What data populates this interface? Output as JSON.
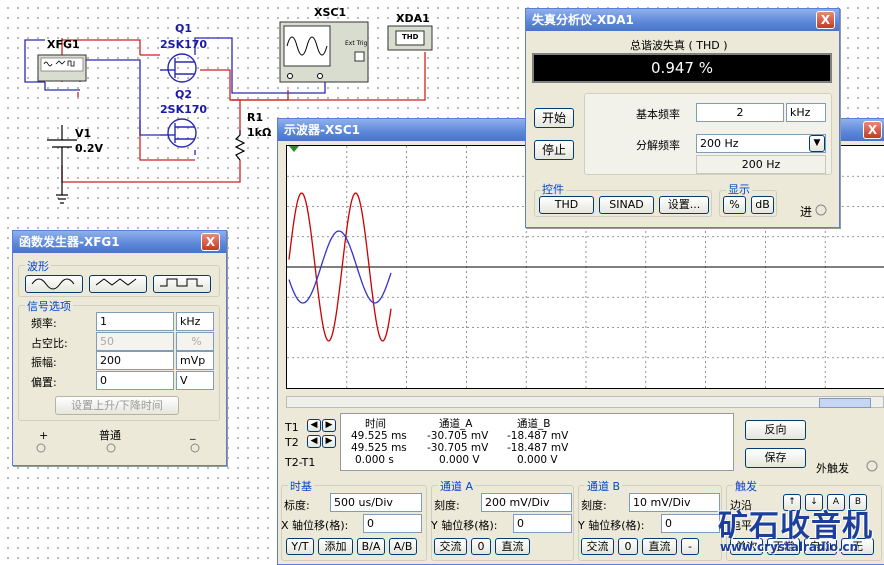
{
  "schematic": {
    "xfg1": "XFG1",
    "q1": "Q1",
    "q1_part": "2SK170",
    "q2": "Q2",
    "q2_part": "2SK170",
    "xsc1": "XSC1",
    "xsc1_ext": "Ext Trig",
    "xda1": "XDA1",
    "xda1_thd": "THD",
    "r1": "R1",
    "r1_val": "1kΩ",
    "v1": "V1",
    "v1_val": "0.2V"
  },
  "func_gen": {
    "title": "函数发生器-XFG1",
    "close": "X",
    "waveform_group": "波形",
    "signal_group": "信号选项",
    "freq_label": "频率:",
    "freq_value": "1",
    "freq_unit": "kHz",
    "duty_label": "占空比:",
    "duty_value": "50",
    "duty_unit": "%",
    "amp_label": "振幅:",
    "amp_value": "200",
    "amp_unit": "mVp",
    "offset_label": "偏置:",
    "offset_value": "0",
    "offset_unit": "V",
    "rise_fall_button": "设置上升/下降时间",
    "plus": "+",
    "common": "普通",
    "minus": "_"
  },
  "distortion": {
    "title": "失真分析仪-XDA1",
    "close": "X",
    "header": "总谐波失真 ( THD )",
    "reading": "0.947 %",
    "start_button": "开始",
    "stop_button": "停止",
    "fund_freq_label": "基本频率",
    "fund_freq_value": "2",
    "fund_freq_unit": "kHz",
    "res_freq_label": "分解频率",
    "res_freq_value": "200 Hz",
    "res_freq_display": "200 Hz",
    "controls_group": "控件",
    "thd_button": "THD",
    "sinad_button": "SINAD",
    "settings_button": "设置...",
    "display_group": "显示",
    "percent_button": "%",
    "db_button": "dB",
    "in_label": "进"
  },
  "scope": {
    "title": "示波器-XSC1",
    "close": "X",
    "t1": "T1",
    "t2": "T2",
    "t2t1": "T2-T1",
    "hdr_time": "时间",
    "hdr_cha": "通道_A",
    "hdr_chb": "通道_B",
    "row1_time": "49.525 ms",
    "row1_a": "-30.705 mV",
    "row1_b": "-18.487 mV",
    "row2_time": "49.525 ms",
    "row2_a": "-30.705 mV",
    "row2_b": "-18.487 mV",
    "row3_time": "0.000 s",
    "row3_a": "0.000 V",
    "row3_b": "0.000 V",
    "reverse_button": "反向",
    "save_button": "保存",
    "ext_trigger": "外触发",
    "timebase_group": "时基",
    "scale_label": "标度:",
    "timebase_value": "500 us/Div",
    "xpos_label": "X 轴位移(格):",
    "xpos_value": "0",
    "yt_button": "Y/T",
    "add_button": "添加",
    "ba_button": "B/A",
    "ab_button": "A/B",
    "cha_group": "通道 A",
    "cha_scale_label": "刻度:",
    "cha_scale_value": "200 mV/Div",
    "cha_ypos_label": "Y 轴位移(格):",
    "cha_ypos_value": "0",
    "cha_ac": "交流",
    "cha_zero": "0",
    "cha_dc": "直流",
    "chb_group": "通道 B",
    "chb_scale_label": "刻度:",
    "chb_scale_value": "10 mV/Div",
    "chb_ypos_label": "Y 轴位移(格):",
    "chb_ypos_value": "0",
    "chb_ac": "交流",
    "chb_zero": "0",
    "chb_dc": "直流",
    "chb_minus": "-",
    "trig_group": "触发",
    "trig_edge": "边沿",
    "trig_level": "电平",
    "single_button": "单次",
    "normal_button": "正常",
    "auto_button": "自动",
    "none_button": "无"
  },
  "watermark": {
    "brand": "矿石收音机",
    "url": "www.crystalradio.cn"
  },
  "colors": {
    "channel_a": "#cc0000",
    "channel_b": "#3333cc",
    "title_blue": "#4a74c9"
  }
}
